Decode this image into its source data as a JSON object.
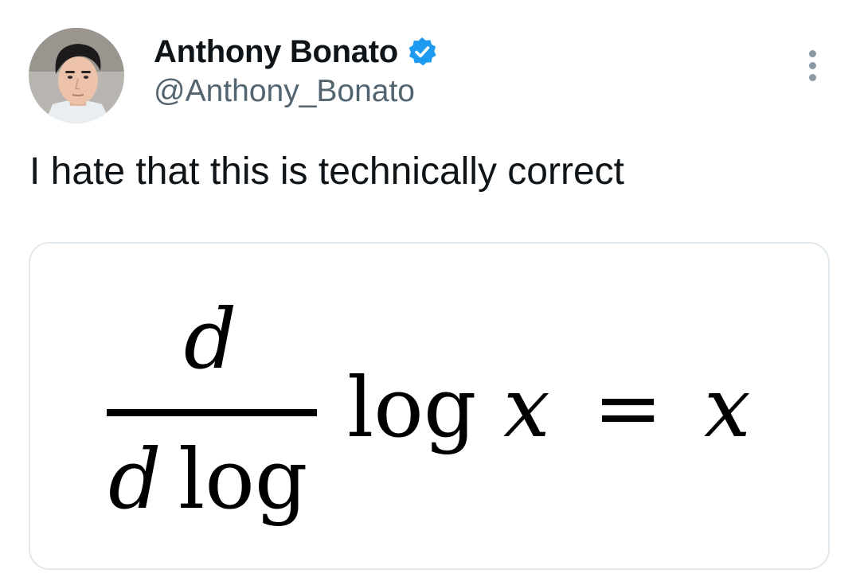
{
  "author": {
    "display_name": "Anthony Bonato",
    "handle": "@Anthony_Bonato",
    "verified": true,
    "verified_icon": "verified-badge-icon",
    "avatar_icon": "profile-photo"
  },
  "tweet": {
    "text": "I hate that this is technically correct"
  },
  "media": {
    "formula": {
      "numerator": "d",
      "denominator_d": "d",
      "denominator_log": "log",
      "log": "log",
      "x1": "x",
      "equals": "=",
      "x2": "x"
    }
  },
  "actions": {
    "more_icon": "more-options-icon"
  },
  "colors": {
    "text_primary": "#0f1419",
    "text_secondary": "#536471",
    "verified_blue": "#1d9bf0",
    "card_border": "#e1e8ed"
  }
}
